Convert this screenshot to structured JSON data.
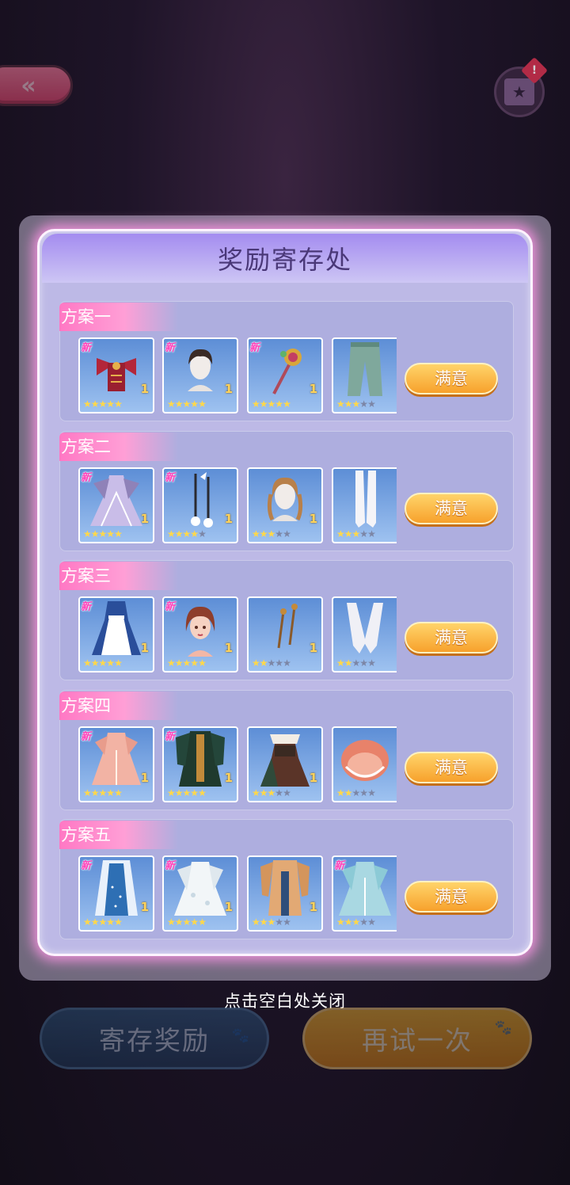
{
  "top": {
    "back_icon": "double-chevron-left",
    "gift_icon": "gift-box-star",
    "gift_badge": "!"
  },
  "modal": {
    "title": "奖励寄存处"
  },
  "plans": [
    {
      "label": "方案一",
      "button": "满意",
      "items": [
        {
          "name": "red-bow-top",
          "new": true,
          "count": "1",
          "stars": 5,
          "max": 5
        },
        {
          "name": "short-hair-head",
          "new": true,
          "count": "1",
          "stars": 5,
          "max": 5
        },
        {
          "name": "candy-wand",
          "new": true,
          "count": "1",
          "stars": 5,
          "max": 5
        },
        {
          "name": "green-pants",
          "new": false,
          "count": "",
          "stars": 3,
          "max": 5
        }
      ]
    },
    {
      "label": "方案二",
      "button": "满意",
      "items": [
        {
          "name": "lavender-gown",
          "new": true,
          "count": "1",
          "stars": 5,
          "max": 5
        },
        {
          "name": "ribbon-earrings",
          "new": true,
          "count": "1",
          "stars": 4,
          "max": 5
        },
        {
          "name": "braided-hair-head",
          "new": false,
          "count": "1",
          "stars": 3,
          "max": 5
        },
        {
          "name": "white-stockings",
          "new": false,
          "count": "",
          "stars": 3,
          "max": 5
        }
      ]
    },
    {
      "label": "方案三",
      "button": "满意",
      "items": [
        {
          "name": "maid-dress",
          "new": true,
          "count": "1",
          "stars": 5,
          "max": 5
        },
        {
          "name": "auburn-hair-face",
          "new": true,
          "count": "1",
          "stars": 5,
          "max": 5
        },
        {
          "name": "bronze-hairpins",
          "new": false,
          "count": "1",
          "stars": 2,
          "max": 5
        },
        {
          "name": "white-gloves",
          "new": false,
          "count": "",
          "stars": 2,
          "max": 5
        }
      ]
    },
    {
      "label": "方案四",
      "button": "满意",
      "items": [
        {
          "name": "peach-gown",
          "new": true,
          "count": "1",
          "stars": 5,
          "max": 5
        },
        {
          "name": "dark-green-coat",
          "new": true,
          "count": "1",
          "stars": 5,
          "max": 5
        },
        {
          "name": "brown-corset-dress",
          "new": false,
          "count": "1",
          "stars": 3,
          "max": 5
        },
        {
          "name": "peach-bonnet",
          "new": false,
          "count": "",
          "stars": 2,
          "max": 5
        }
      ]
    },
    {
      "label": "方案五",
      "button": "满意",
      "items": [
        {
          "name": "blue-robe",
          "new": true,
          "count": "1",
          "stars": 5,
          "max": 5
        },
        {
          "name": "white-floral-gown",
          "new": true,
          "count": "1",
          "stars": 5,
          "max": 5
        },
        {
          "name": "tan-long-coat",
          "new": false,
          "count": "1",
          "stars": 3,
          "max": 5
        },
        {
          "name": "pale-blue-gown",
          "new": true,
          "count": "",
          "stars": 3,
          "max": 5
        }
      ]
    }
  ],
  "new_tag": "新",
  "close_hint": "点击空白处关闭",
  "bottom": {
    "deposit": "寄存奖励",
    "retry": "再试一次"
  },
  "colors": {
    "accent_pink": "#ff78c4",
    "gold_button": "#f7a12c",
    "panel": "#bdb9e6",
    "item_bg": "#5d8ed6"
  }
}
